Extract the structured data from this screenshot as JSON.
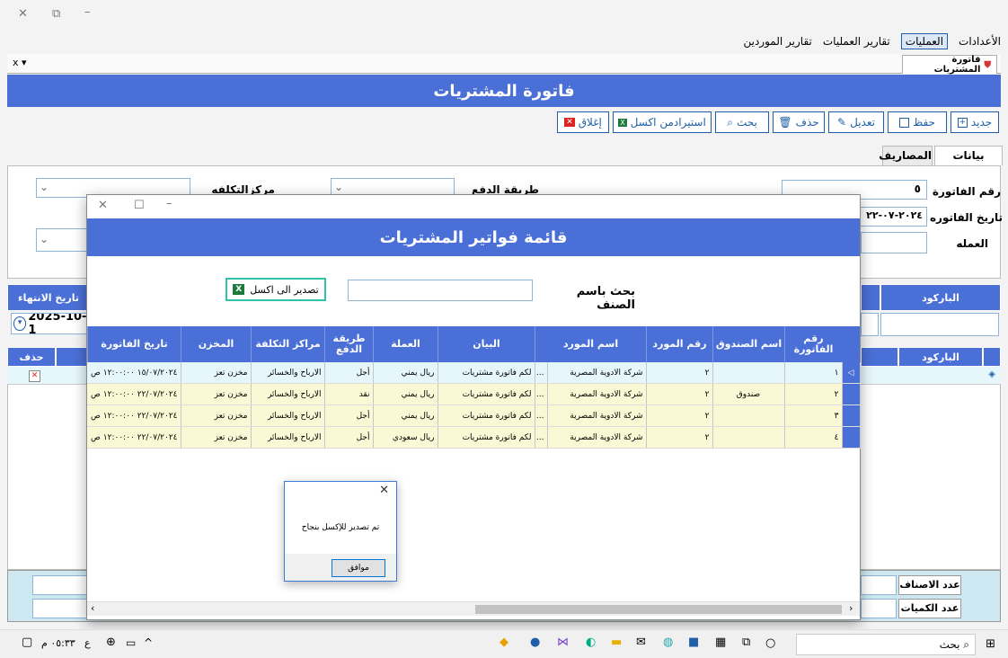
{
  "menubar": {
    "items": [
      "الأعدادات",
      "العمليات",
      "تقارير العمليات",
      "تقارير الموردين"
    ]
  },
  "doc_tab": {
    "label": "فاتورة المشتريات"
  },
  "close_all_label": "x ▾",
  "main": {
    "title": "فاتورة المشتريات",
    "toolbar": {
      "new": "جديد",
      "save": "حفظ",
      "edit": "تعديل",
      "delete": "حذف",
      "search": "بحث",
      "import_excel": "استيرادمن اكسل",
      "close": "إغلاق"
    },
    "tabs": [
      "بيانات الرئيسيه",
      "المصاريف"
    ],
    "fields": {
      "invoice_no_label": "رقم الفاتورة",
      "invoice_no": "٥",
      "invoice_date_label": "تاريخ الفاتوره",
      "invoice_date": "٢٠٢٤-٠٧-٢٢ ‏",
      "currency_label": "العمله",
      "payment_method_label": "طريقة الدفع",
      "cost_center_label": "مركزالتكلفه"
    },
    "left_header": "تاريخ الانتهاء",
    "left_date": "2025-10-1",
    "barcode_label": "الباركود",
    "grid_headers": {
      "barcode": "الباركود",
      "delete": "حذف"
    },
    "footer": {
      "items_count_label": "عدد الاصناف",
      "qty_count_label": "عدد الكميات"
    }
  },
  "dialog": {
    "title": "قائمة فواتير المشتريات",
    "search_label": "بحث باسم الصنف",
    "search_value": "",
    "export_button": "تصدير الى اكسل",
    "columns": [
      "رقم الفاتورة",
      "اسم الصندوق",
      "رقم المورد",
      "اسم المورد",
      "البيان",
      "العملة",
      "طريقة الدفع",
      "مراكز التكلفة",
      "المخزن",
      "تاريخ الفاتورة"
    ],
    "rows": [
      [
        "١",
        "",
        "٢",
        "شركة الادوية المصرية",
        "...",
        "لكم فاتورة مشتريات",
        "ريال يمني",
        "أجل",
        "الارباح والخسائر",
        "مخزن تعز",
        "١٥/٠٧/٢٠٢٤ ١٢:٠٠:٠٠ ص"
      ],
      [
        "٢",
        "صندوق",
        "٢",
        "شركة الادوية المصرية",
        "...",
        "لكم فاتورة مشتريات",
        "ريال يمني",
        "نقد",
        "الارباح والخسائر",
        "مخزن تعز",
        "٢٢/٠٧/٢٠٢٤ ١٢:٠٠:٠٠ ص"
      ],
      [
        "٣",
        "",
        "٢",
        "شركة الادوية المصرية",
        "...",
        "لكم فاتورة مشتريات",
        "ريال يمني",
        "أجل",
        "الارباح والخسائر",
        "مخزن تعز",
        "٢٢/٠٧/٢٠٢٤ ١٢:٠٠:٠٠ ص"
      ],
      [
        "٤",
        "",
        "٢",
        "شركة الادوية المصرية",
        "...",
        "لكم فاتورة مشتريات",
        "ريال سعودي",
        "أجل",
        "الارباح والخسائر",
        "مخزن تعز",
        "٢٢/٠٧/٢٠٢٤ ١٢:٠٠:٠٠ ص"
      ]
    ]
  },
  "message_box": {
    "text": "تم تصدير للإكسل بنجاح",
    "ok": "موافق"
  },
  "taskbar": {
    "search_placeholder": "بحث",
    "time": "٠٥:٣٣ م",
    "lang": "ع"
  },
  "colors": {
    "accent_blue": "#4a6fd6",
    "toolbar_blue": "#1f5fa8",
    "row_blue": "#e6f7fb",
    "row_yellow": "#fbf9d5"
  }
}
